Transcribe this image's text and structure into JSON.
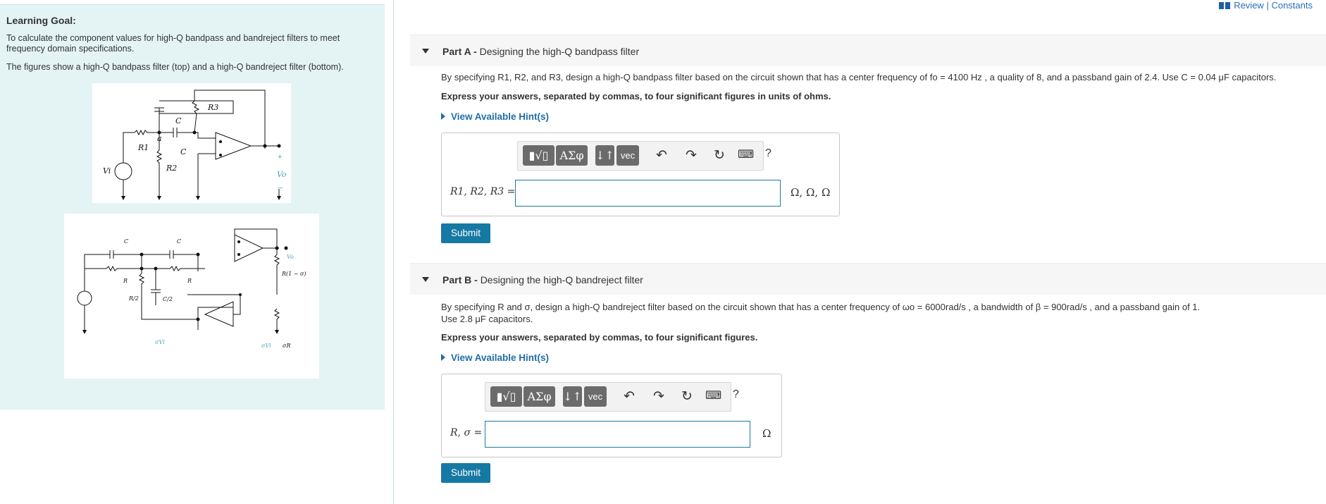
{
  "top_links": {
    "review": "Review",
    "separator": "|",
    "constants": "Constants"
  },
  "sidebar": {
    "title": "Learning Goal:",
    "goal": "To calculate the component values for high-Q bandpass and bandreject filters to meet frequency domain specifications.",
    "figures_caption": "The figures show a high-Q bandpass filter (top) and a high-Q bandreject filter (bottom).",
    "fig1_labels": {
      "r1": "R1",
      "r2": "R2",
      "r3": "R3",
      "c_top": "C",
      "c_mid": "C",
      "node_a": "a",
      "vi": "Vi",
      "vo": "Vo",
      "plus": "+",
      "minus": "−"
    },
    "fig2_labels": {
      "c1": "C",
      "c2": "C",
      "r1": "R",
      "r2": "R",
      "r_half": "R/2",
      "c_double": "C/2",
      "r_top": "R(1 − σ)",
      "r_bottom": "σR",
      "vo": "Vo",
      "svi": "σVi"
    }
  },
  "part_a": {
    "prefix": "Part A -",
    "title": "Designing the high-Q bandpass filter",
    "prompt": "By specifying R1, R2, and R3, design a high-Q bandpass filter based on the circuit shown that has a center frequency of fo = 4100 Hz , a quality of 8, and a passband gain of 2.4. Use C = 0.04 μF capacitors.",
    "instruction": "Express your answers, separated by commas, to four significant figures in units of ohms.",
    "hint": "View Available Hint(s)",
    "field_label": "R1, R2, R3 =",
    "field_value": "",
    "units": "Ω, Ω, Ω",
    "submit": "Submit"
  },
  "part_b": {
    "prefix": "Part B -",
    "title": "Designing the high-Q bandreject filter",
    "prompt_line1": "By specifying R and σ, design a high-Q bandreject filter based on the circuit shown that has a center frequency of ωo = 6000rad/s , a bandwidth of β = 900rad/s , and a passband gain of 1.",
    "prompt_line2": "Use 2.8 μF capacitors.",
    "instruction": "Express your answers, separated by commas, to four significant figures.",
    "hint": "View Available Hint(s)",
    "field_label": "R, σ =",
    "field_value": "",
    "units": "Ω",
    "submit": "Submit"
  },
  "toolbar": {
    "templates": "▮√▯",
    "greek": "ΑΣφ",
    "arrows": "↓↑",
    "vec": "vec",
    "undo": "↶",
    "redo": "↷",
    "reset": "↻",
    "keyboard": "⌨",
    "help": "?"
  }
}
